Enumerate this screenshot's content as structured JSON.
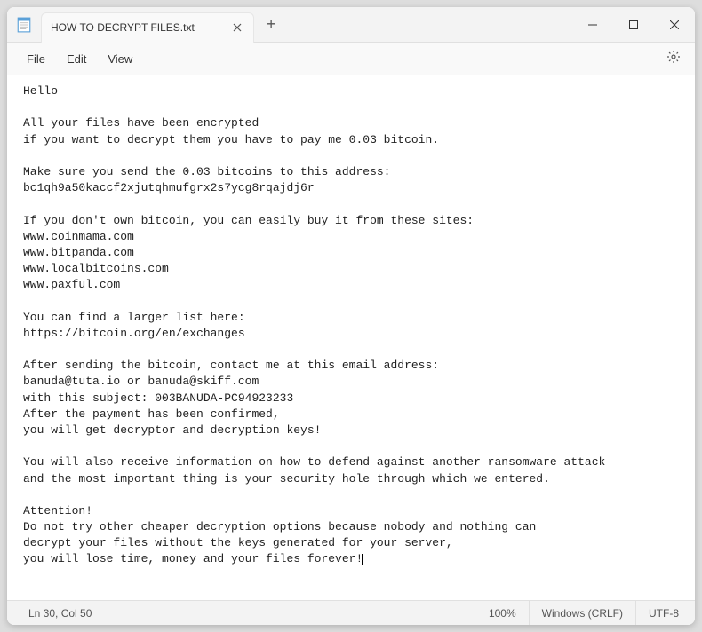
{
  "tab": {
    "filename": "HOW TO DECRYPT FILES.txt"
  },
  "menu": {
    "file": "File",
    "edit": "Edit",
    "view": "View"
  },
  "content": "Hello\n\nAll your files have been encrypted\nif you want to decrypt them you have to pay me 0.03 bitcoin.\n\nMake sure you send the 0.03 bitcoins to this address:\nbc1qh9a50kaccf2xjutqhmufgrx2s7ycg8rqajdj6r\n\nIf you don't own bitcoin, you can easily buy it from these sites:\nwww.coinmama.com\nwww.bitpanda.com\nwww.localbitcoins.com\nwww.paxful.com\n\nYou can find a larger list here:\nhttps://bitcoin.org/en/exchanges\n\nAfter sending the bitcoin, contact me at this email address:\nbanuda@tuta.io or banuda@skiff.com\nwith this subject: 003BANUDA-PC94923233\nAfter the payment has been confirmed,\nyou will get decryptor and decryption keys!\n\nYou will also receive information on how to defend against another ransomware attack\nand the most important thing is your security hole through which we entered.\n\nAttention!\nDo not try other cheaper decryption options because nobody and nothing can\ndecrypt your files without the keys generated for your server,\nyou will lose time, money and your files forever!",
  "statusbar": {
    "position": "Ln 30, Col 50",
    "zoom": "100%",
    "lineEnding": "Windows (CRLF)",
    "encoding": "UTF-8"
  }
}
